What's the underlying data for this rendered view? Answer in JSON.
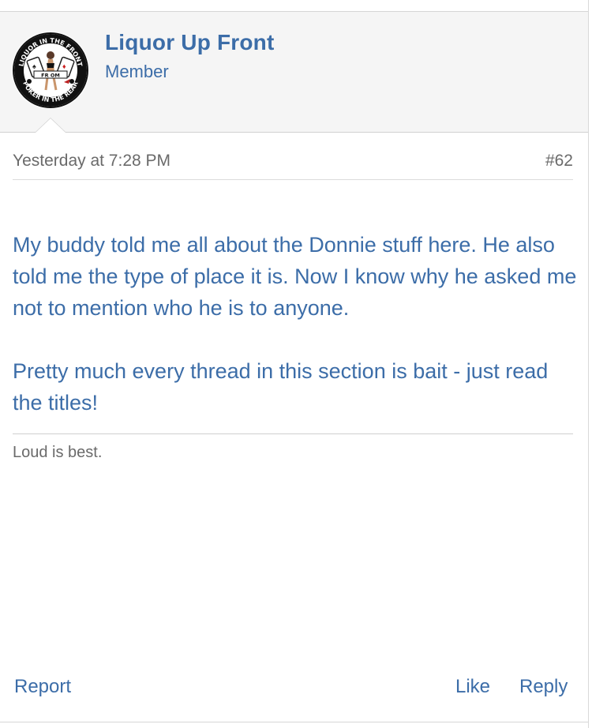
{
  "post": {
    "author": {
      "name": "Liquor Up Front",
      "role": "Member",
      "avatar_text_top": "LIQUOR IN THE FRONT",
      "avatar_text_bottom": "POKER IN THE REAR",
      "avatar_badge": "FR  OM"
    },
    "timestamp": "Yesterday at 7:28 PM",
    "number": "#62",
    "paragraphs": [
      "My buddy told me all about the Donnie stuff here. He also told me the type of place it is. Now I know why he asked me not to mention who he is to anyone.",
      "Pretty much every thread in this section is bait - just read the titles!"
    ],
    "signature": "Loud is best."
  },
  "actions": {
    "report": "Report",
    "like": "Like",
    "reply": "Reply"
  },
  "colors": {
    "link": "#3c6da8",
    "meta_text": "#6a6a6a",
    "header_bg": "#f5f5f5"
  }
}
